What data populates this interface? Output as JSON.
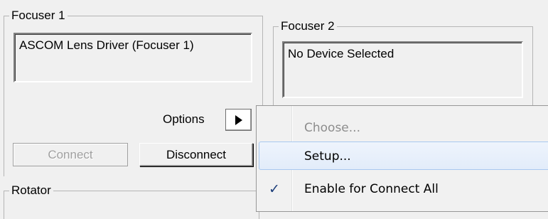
{
  "focuser1": {
    "group_label": "Focuser 1",
    "device": "ASCOM Lens Driver (Focuser 1)",
    "options_label": "Options",
    "connect_label": "Connect",
    "disconnect_label": "Disconnect"
  },
  "focuser2": {
    "group_label": "Focuser 2",
    "device": "No Device Selected"
  },
  "rotator": {
    "group_label": "Rotator"
  },
  "context_menu": {
    "items": [
      {
        "label": "Choose...",
        "state": "disabled"
      },
      {
        "label": "Setup...",
        "state": "hover"
      },
      {
        "label": "Enable for Connect All",
        "checked": true,
        "check_glyph": "✓"
      }
    ]
  },
  "icons": {
    "options_arrow": "triangle-right-icon",
    "check": "checkmark-icon"
  }
}
